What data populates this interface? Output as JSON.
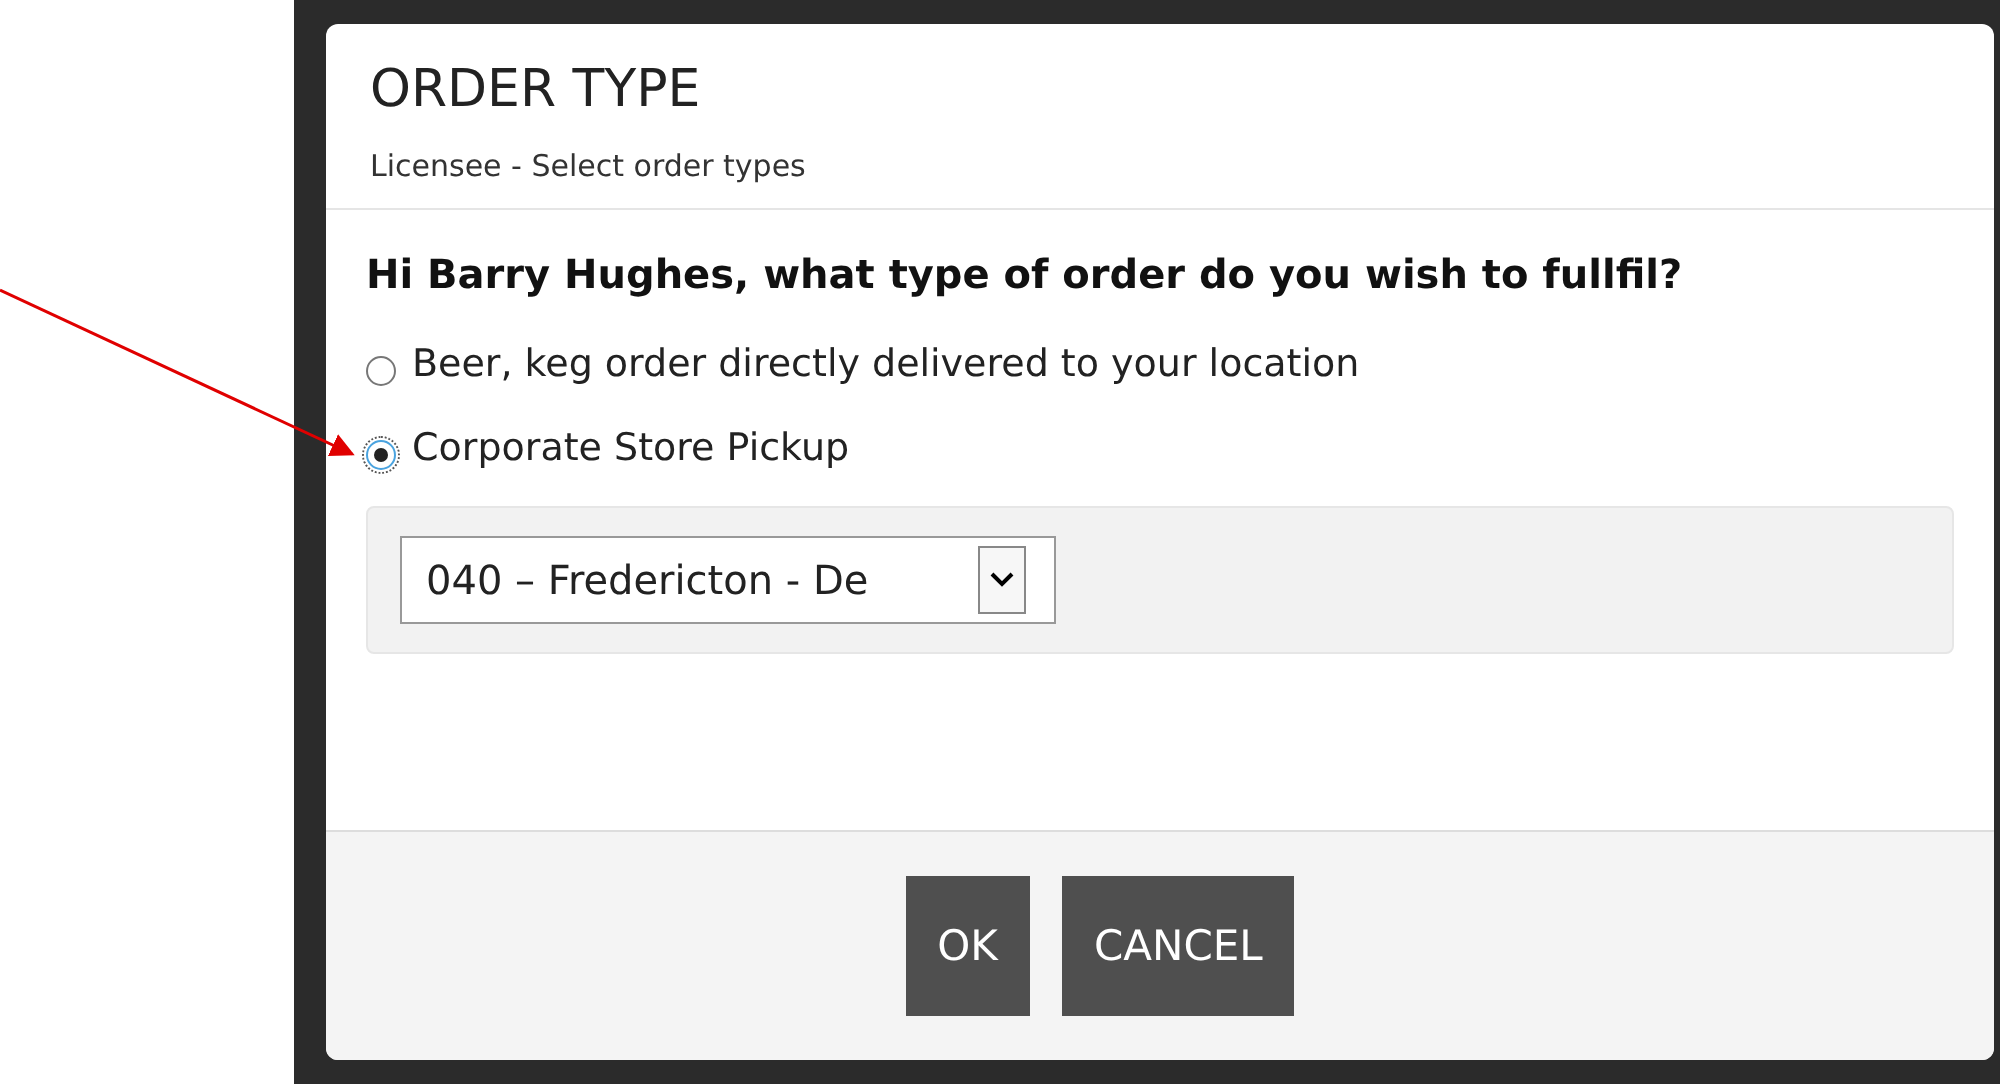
{
  "dialog": {
    "title": "ORDER TYPE",
    "subtitle": "Licensee - Select order types",
    "question": "Hi Barry Hughes, what type of order do you wish to fullfil?",
    "options": [
      {
        "label": "Beer, keg order directly delivered to your location",
        "selected": false
      },
      {
        "label": "Corporate Store Pickup",
        "selected": true
      }
    ],
    "store_select": {
      "value": "040 – Fredericton - De"
    },
    "buttons": [
      "OK",
      "CANCEL"
    ]
  }
}
